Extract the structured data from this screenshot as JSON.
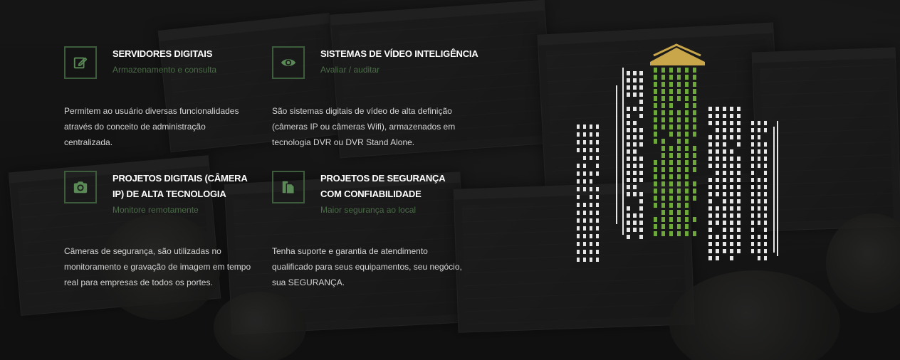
{
  "features": [
    {
      "icon": "edit-icon",
      "title": "SERVIDORES DIGITAIS",
      "subtitle": "Armazenamento e consulta",
      "description": "Permitem ao usuário diversas funcionalidades através do conceito de administração centralizada."
    },
    {
      "icon": "eye-icon",
      "title": "SISTEMAS DE VÍDEO INTELIGÊNCIA",
      "subtitle": "Avaliar / auditar",
      "description": "São sistemas digitais de vídeo de alta definição (câmeras IP ou câmeras Wifi), armazenados em tecnologia DVR ou DVR Stand Alone."
    },
    {
      "icon": "camera-icon",
      "title": "PROJETOS DIGITAIS (CÂMERA IP) DE ALTA TECNOLOGIA",
      "subtitle": "Monitore remotamente",
      "description": "Câmeras de segurança, são utilizadas no monitoramento e gravação de imagem em tempo real para empresas de todos os portes."
    },
    {
      "icon": "documents-icon",
      "title": "PROJETOS DE SEGURANÇA COM CONFIABILIDADE",
      "subtitle": "Maior segurança ao local",
      "description": "Tenha suporte e garantia de atendimento qualificado para seus equipamentos, seu negócio, sua SEGURANÇA."
    }
  ],
  "colors": {
    "icon_border": "#3c5c3c",
    "icon": "#5a8a55",
    "subtitle": "#4a6b47",
    "building_green": "#6fa83a",
    "building_gold": "#c9a64a",
    "building_white": "#e6e6e6"
  },
  "illustration": "city-buildings-icon"
}
